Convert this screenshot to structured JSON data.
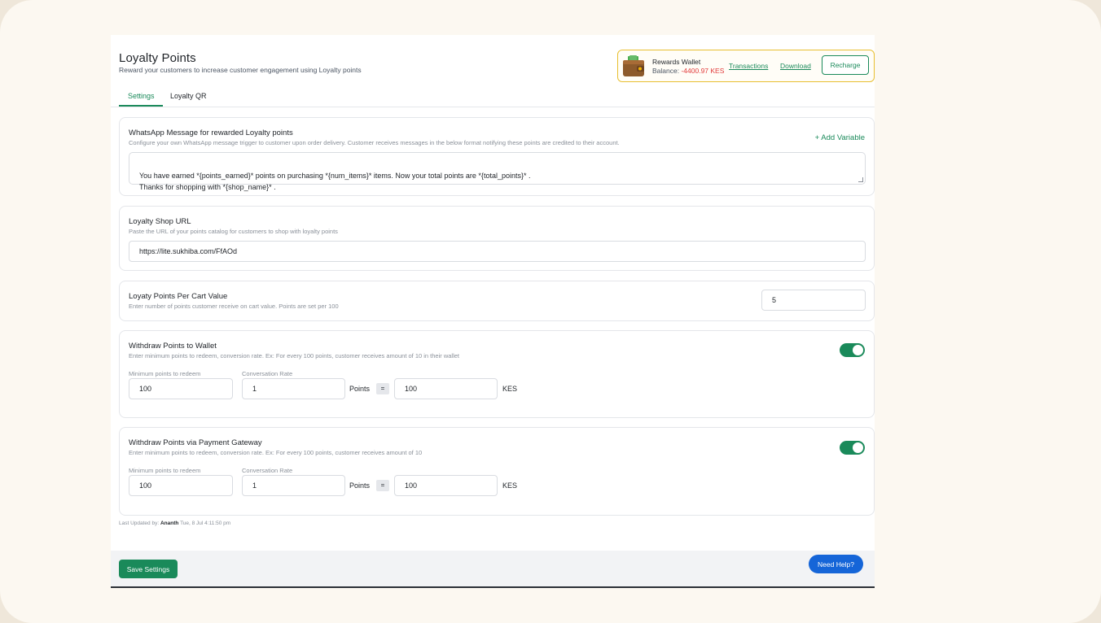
{
  "header": {
    "title": "Loyalty Points",
    "subtitle": "Reward your customers to increase customer engagement using Loyalty points"
  },
  "wallet": {
    "title": "Rewards Wallet",
    "balance_label": "Balance:",
    "balance_value": "-4400.97 KES",
    "transactions_label": "Transactions",
    "download_label": "Download",
    "recharge_label": "Recharge"
  },
  "tabs": [
    {
      "label": "Settings",
      "active": true
    },
    {
      "label": "Loyalty QR",
      "active": false
    }
  ],
  "whatsapp": {
    "title": "WhatsApp Message for rewarded Loyalty points",
    "description": "Configure your own WhatsApp message trigger to customer upon order delivery. Customer receives messages in the below format notifying these points are credited to their account.",
    "add_variable": "+ Add Variable",
    "message": "You have earned *{points_earned}* points on purchasing *{num_items}* items. Now your total points are *{total_points}* .\nThanks for shopping with *{shop_name}* ."
  },
  "shop_url": {
    "title": "Loyalty Shop URL",
    "description": "Paste the URL of your points catalog for customers to shop with loyalty points",
    "value": "https://lite.sukhiba.com/FfAOd"
  },
  "per_cart": {
    "title": "Loyaty Points Per Cart Value",
    "description": "Enter number of points customer receive on cart value. Points are set per 100",
    "value": "5"
  },
  "withdraw_wallet": {
    "title": "Withdraw Points to Wallet",
    "description": "Enter minimum points to redeem, conversion rate. Ex: For every 100 points, customer receives amount of 10 in their wallet",
    "min_label": "Minimum points to redeem",
    "rate_label": "Conversation Rate",
    "min_value": "100",
    "points_value": "1",
    "points_unit": "Points",
    "equals": "=",
    "amount_value": "100",
    "currency": "KES",
    "enabled": true
  },
  "withdraw_gateway": {
    "title": "Withdraw Points via Payment Gateway",
    "description": "Enter minimum points to redeem, conversion rate. Ex: For every 100 points, customer receives amount of 10",
    "min_label": "Minimum points to redeem",
    "rate_label": "Conversation Rate",
    "min_value": "100",
    "points_value": "1",
    "points_unit": "Points",
    "equals": "=",
    "amount_value": "100",
    "currency": "KES",
    "enabled": true
  },
  "last_updated": {
    "label": "Last Updated by:",
    "user": "Ananth",
    "timestamp": "Tue, 8 Jul 4:11:50 pm"
  },
  "footer": {
    "save_label": "Save Settings",
    "help_label": "Need Help?"
  },
  "colors": {
    "accent": "#1a8a5a",
    "help_button": "#1565d8",
    "negative": "#e23b3b",
    "wallet_border": "#e8bf2f"
  },
  "icons": [
    "wallet-icon",
    "toggle-switch"
  ]
}
